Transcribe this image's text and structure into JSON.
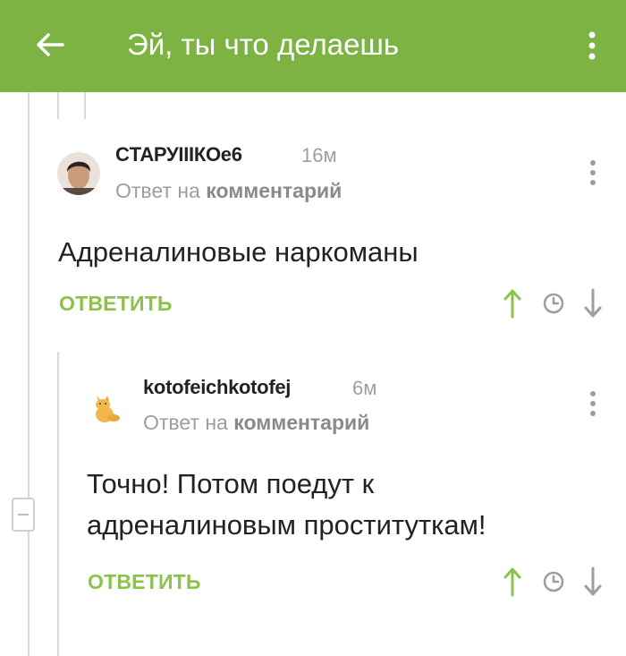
{
  "appbar": {
    "title": "Эй, ты что делаешь",
    "back_icon": "arrow-left-icon",
    "more_icon": "more-vertical-icon",
    "background": "#7cb342"
  },
  "comments": [
    {
      "author": "CТАРУIIIКОе6",
      "time": "16м",
      "reply_prefix": "Ответ на",
      "reply_link": "комментарий",
      "body": "Адреналиновые наркоманы",
      "reply_label": "ОТВЕТИТЬ"
    },
    {
      "author": "kotofeichkotofej",
      "time": "6м",
      "reply_prefix": "Ответ на",
      "reply_link": "комментарий",
      "body_line1": "Точно! Потом поедут к",
      "body_line2": "адреналиновым проституткам!",
      "reply_label": "ОТВЕТИТЬ"
    }
  ],
  "colors": {
    "accent": "#8bc34a",
    "text": "#222222",
    "muted": "#9e9e9e"
  }
}
